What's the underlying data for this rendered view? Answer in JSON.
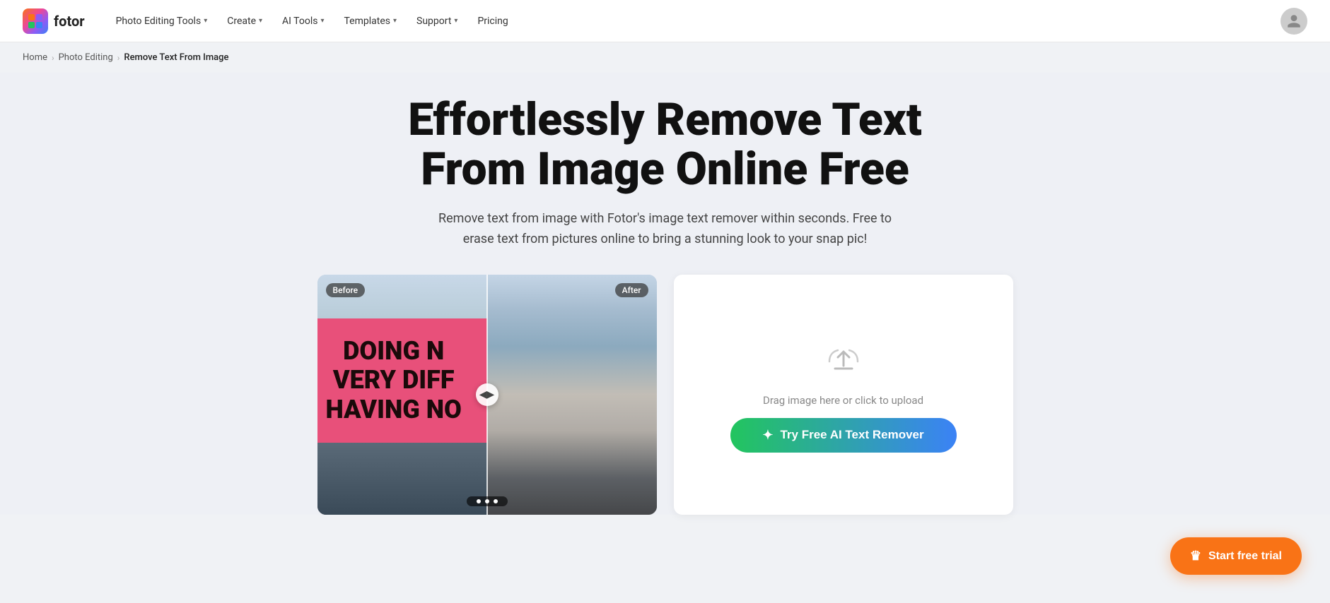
{
  "brand": {
    "name": "fotor",
    "logo_alt": "Fotor logo"
  },
  "nav": {
    "items": [
      {
        "label": "Photo Editing Tools",
        "has_dropdown": true
      },
      {
        "label": "Create",
        "has_dropdown": true
      },
      {
        "label": "AI Tools",
        "has_dropdown": true
      },
      {
        "label": "Templates",
        "has_dropdown": true
      },
      {
        "label": "Support",
        "has_dropdown": true
      },
      {
        "label": "Pricing",
        "has_dropdown": false
      }
    ]
  },
  "breadcrumb": {
    "home": "Home",
    "photo_editing": "Photo Editing",
    "current": "Remove Text From Image"
  },
  "hero": {
    "title": "Effortlessly Remove Text\nFrom Image Online Free",
    "subtitle": "Remove text from image with Fotor's image text remover within seconds. Free to erase text from pictures online to bring a stunning look to your snap pic!"
  },
  "demo": {
    "before_label": "Before",
    "after_label": "After",
    "billboard_lines": [
      "DOING N",
      "VERY DIFF",
      "HAVING NO"
    ],
    "drag_hint": "◀ ▶"
  },
  "upload": {
    "drag_text": "Drag image here or click to upload",
    "button_label": "Try Free AI Text Remover"
  },
  "trial": {
    "button_label": "Start free trial"
  }
}
